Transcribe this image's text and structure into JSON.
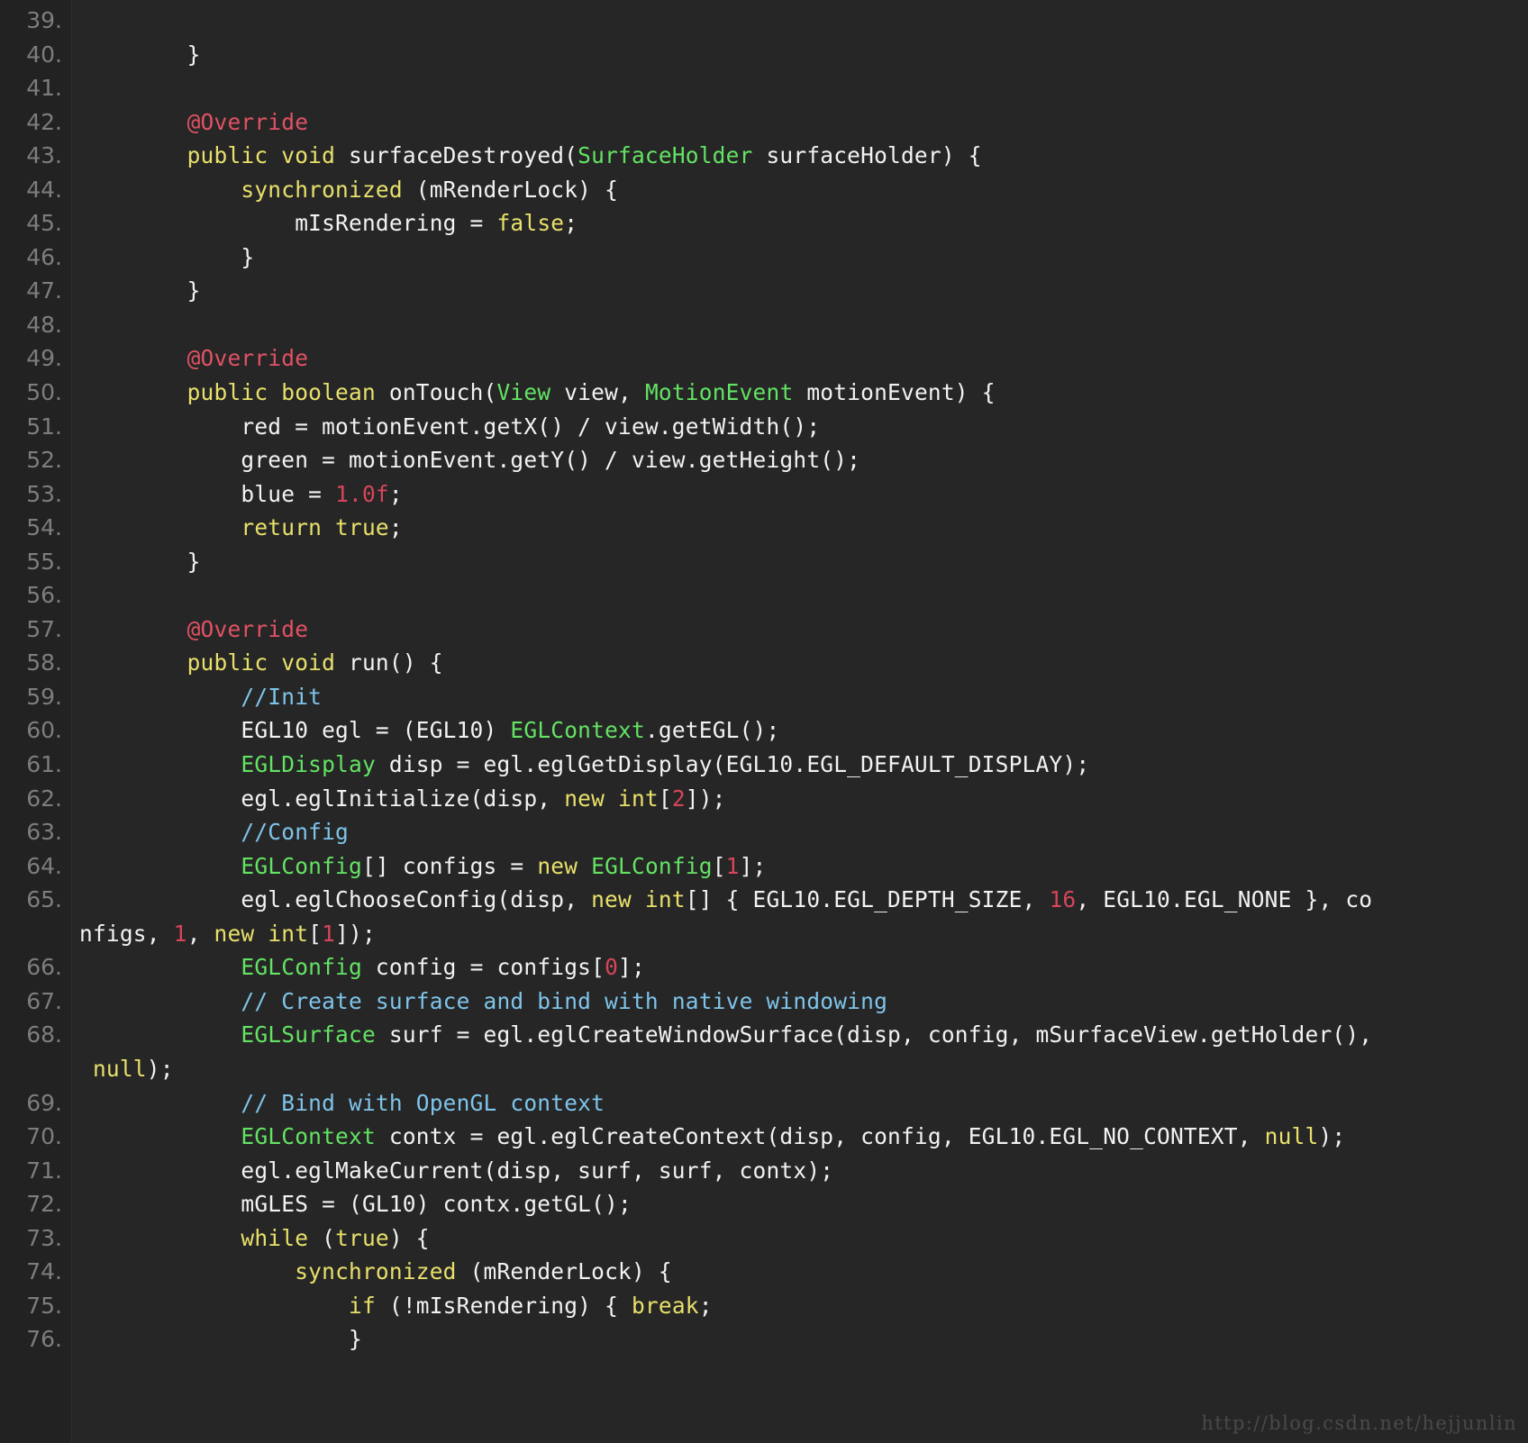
{
  "editor": {
    "background_color": "#262626",
    "gutter_color": "#222222",
    "line_number_color": "#7d7d7d",
    "language": "Java"
  },
  "colors": {
    "keyword": "#e8e06a",
    "type": "#63e363",
    "comment": "#7ec4ea",
    "annotation": "#e05264",
    "number": "#d6455a",
    "text": "#f2f2f2"
  },
  "watermark": {
    "text": "http://blog.csdn.net/hejjunlin"
  },
  "gutter": {
    "numbers": [
      "39.",
      "40.",
      "41.",
      "42.",
      "43.",
      "44.",
      "45.",
      "46.",
      "47.",
      "48.",
      "49.",
      "50.",
      "51.",
      "52.",
      "53.",
      "54.",
      "55.",
      "56.",
      "57.",
      "58.",
      "59.",
      "60.",
      "61.",
      "62.",
      "63.",
      "64.",
      "65.",
      "",
      "66.",
      "67.",
      "68.",
      "",
      "69.",
      "70.",
      "71.",
      "72.",
      "73.",
      "74.",
      "75.",
      "76."
    ]
  },
  "code": {
    "lines": [
      {
        "number": "39.",
        "tokens": []
      },
      {
        "number": "40.",
        "tokens": [
          {
            "t": "        }",
            "c": "txt"
          }
        ]
      },
      {
        "number": "41.",
        "tokens": []
      },
      {
        "number": "42.",
        "tokens": [
          {
            "t": "        ",
            "c": "txt"
          },
          {
            "t": "@Override",
            "c": "ann"
          }
        ]
      },
      {
        "number": "43.",
        "tokens": [
          {
            "t": "        ",
            "c": "txt"
          },
          {
            "t": "public void ",
            "c": "kw"
          },
          {
            "t": "surfaceDestroyed(",
            "c": "txt"
          },
          {
            "t": "SurfaceHolder",
            "c": "type"
          },
          {
            "t": " surfaceHolder) {",
            "c": "txt"
          }
        ]
      },
      {
        "number": "44.",
        "tokens": [
          {
            "t": "            ",
            "c": "txt"
          },
          {
            "t": "synchronized",
            "c": "kw"
          },
          {
            "t": " (mRenderLock) {",
            "c": "txt"
          }
        ]
      },
      {
        "number": "45.",
        "tokens": [
          {
            "t": "                mIsRendering = ",
            "c": "txt"
          },
          {
            "t": "false",
            "c": "kw"
          },
          {
            "t": ";",
            "c": "txt"
          }
        ]
      },
      {
        "number": "46.",
        "tokens": [
          {
            "t": "            }",
            "c": "txt"
          }
        ]
      },
      {
        "number": "47.",
        "tokens": [
          {
            "t": "        }",
            "c": "txt"
          }
        ]
      },
      {
        "number": "48.",
        "tokens": []
      },
      {
        "number": "49.",
        "tokens": [
          {
            "t": "        ",
            "c": "txt"
          },
          {
            "t": "@Override",
            "c": "ann"
          }
        ]
      },
      {
        "number": "50.",
        "tokens": [
          {
            "t": "        ",
            "c": "txt"
          },
          {
            "t": "public boolean ",
            "c": "kw"
          },
          {
            "t": "onTouch(",
            "c": "txt"
          },
          {
            "t": "View",
            "c": "type"
          },
          {
            "t": " view, ",
            "c": "txt"
          },
          {
            "t": "MotionEvent",
            "c": "type"
          },
          {
            "t": " motionEvent) {",
            "c": "txt"
          }
        ]
      },
      {
        "number": "51.",
        "tokens": [
          {
            "t": "            red = motionEvent.getX() / view.getWidth();",
            "c": "txt"
          }
        ]
      },
      {
        "number": "52.",
        "tokens": [
          {
            "t": "            green = motionEvent.getY() / view.getHeight();",
            "c": "txt"
          }
        ]
      },
      {
        "number": "53.",
        "tokens": [
          {
            "t": "            blue = ",
            "c": "txt"
          },
          {
            "t": "1.0f",
            "c": "num"
          },
          {
            "t": ";",
            "c": "txt"
          }
        ]
      },
      {
        "number": "54.",
        "tokens": [
          {
            "t": "            ",
            "c": "txt"
          },
          {
            "t": "return true",
            "c": "kw"
          },
          {
            "t": ";",
            "c": "txt"
          }
        ]
      },
      {
        "number": "55.",
        "tokens": [
          {
            "t": "        }",
            "c": "txt"
          }
        ]
      },
      {
        "number": "56.",
        "tokens": []
      },
      {
        "number": "57.",
        "tokens": [
          {
            "t": "        ",
            "c": "txt"
          },
          {
            "t": "@Override",
            "c": "ann"
          }
        ]
      },
      {
        "number": "58.",
        "tokens": [
          {
            "t": "        ",
            "c": "txt"
          },
          {
            "t": "public void ",
            "c": "kw"
          },
          {
            "t": "run() {",
            "c": "txt"
          }
        ]
      },
      {
        "number": "59.",
        "tokens": [
          {
            "t": "            ",
            "c": "txt"
          },
          {
            "t": "//Init",
            "c": "cmt"
          }
        ]
      },
      {
        "number": "60.",
        "tokens": [
          {
            "t": "            EGL10 egl = (EGL10) ",
            "c": "txt"
          },
          {
            "t": "EGLContext",
            "c": "type"
          },
          {
            "t": ".getEGL();",
            "c": "txt"
          }
        ]
      },
      {
        "number": "61.",
        "tokens": [
          {
            "t": "            ",
            "c": "txt"
          },
          {
            "t": "EGLDisplay",
            "c": "type"
          },
          {
            "t": " disp = egl.eglGetDisplay(EGL10.EGL_DEFAULT_DISPLAY);",
            "c": "txt"
          }
        ]
      },
      {
        "number": "62.",
        "tokens": [
          {
            "t": "            egl.eglInitialize(disp, ",
            "c": "txt"
          },
          {
            "t": "new int",
            "c": "kw"
          },
          {
            "t": "[",
            "c": "txt"
          },
          {
            "t": "2",
            "c": "num"
          },
          {
            "t": "]);",
            "c": "txt"
          }
        ]
      },
      {
        "number": "63.",
        "tokens": [
          {
            "t": "            ",
            "c": "txt"
          },
          {
            "t": "//Config",
            "c": "cmt"
          }
        ]
      },
      {
        "number": "64.",
        "tokens": [
          {
            "t": "            ",
            "c": "txt"
          },
          {
            "t": "EGLConfig",
            "c": "type"
          },
          {
            "t": "[] configs = ",
            "c": "txt"
          },
          {
            "t": "new ",
            "c": "kw"
          },
          {
            "t": "EGLConfig",
            "c": "type"
          },
          {
            "t": "[",
            "c": "txt"
          },
          {
            "t": "1",
            "c": "num"
          },
          {
            "t": "];",
            "c": "txt"
          }
        ]
      },
      {
        "number": "65.",
        "tokens": [
          {
            "t": "            egl.eglChooseConfig(disp, ",
            "c": "txt"
          },
          {
            "t": "new int",
            "c": "kw"
          },
          {
            "t": "[] { EGL10.EGL_DEPTH_SIZE, ",
            "c": "txt"
          },
          {
            "t": "16",
            "c": "num"
          },
          {
            "t": ", EGL10.EGL_NONE }, co",
            "c": "txt"
          }
        ]
      },
      {
        "number": "",
        "wrap": true,
        "tokens": [
          {
            "t": "nfigs, ",
            "c": "txt"
          },
          {
            "t": "1",
            "c": "num"
          },
          {
            "t": ", ",
            "c": "txt"
          },
          {
            "t": "new int",
            "c": "kw"
          },
          {
            "t": "[",
            "c": "txt"
          },
          {
            "t": "1",
            "c": "num"
          },
          {
            "t": "]);",
            "c": "txt"
          }
        ]
      },
      {
        "number": "66.",
        "tokens": [
          {
            "t": "            ",
            "c": "txt"
          },
          {
            "t": "EGLConfig",
            "c": "type"
          },
          {
            "t": " config = configs[",
            "c": "txt"
          },
          {
            "t": "0",
            "c": "num"
          },
          {
            "t": "];",
            "c": "txt"
          }
        ]
      },
      {
        "number": "67.",
        "tokens": [
          {
            "t": "            ",
            "c": "txt"
          },
          {
            "t": "// Create surface and bind with native windowing",
            "c": "cmt"
          }
        ]
      },
      {
        "number": "68.",
        "tokens": [
          {
            "t": "            ",
            "c": "txt"
          },
          {
            "t": "EGLSurface",
            "c": "type"
          },
          {
            "t": " surf = egl.eglCreateWindowSurface(disp, config, mSurfaceView.getHolder(),",
            "c": "txt"
          }
        ]
      },
      {
        "number": "",
        "wrap": true,
        "tokens": [
          {
            "t": " ",
            "c": "txt"
          },
          {
            "t": "null",
            "c": "kw"
          },
          {
            "t": ");",
            "c": "txt"
          }
        ]
      },
      {
        "number": "69.",
        "tokens": [
          {
            "t": "            ",
            "c": "txt"
          },
          {
            "t": "// Bind with OpenGL context",
            "c": "cmt"
          }
        ]
      },
      {
        "number": "70.",
        "tokens": [
          {
            "t": "            ",
            "c": "txt"
          },
          {
            "t": "EGLContext",
            "c": "type"
          },
          {
            "t": " contx = egl.eglCreateContext(disp, config, EGL10.EGL_NO_CONTEXT, ",
            "c": "txt"
          },
          {
            "t": "null",
            "c": "kw"
          },
          {
            "t": ");",
            "c": "txt"
          }
        ]
      },
      {
        "number": "71.",
        "tokens": [
          {
            "t": "            egl.eglMakeCurrent(disp, surf, surf, contx);",
            "c": "txt"
          }
        ]
      },
      {
        "number": "72.",
        "tokens": [
          {
            "t": "            mGLES = (GL10) contx.getGL();",
            "c": "txt"
          }
        ]
      },
      {
        "number": "73.",
        "tokens": [
          {
            "t": "            ",
            "c": "txt"
          },
          {
            "t": "while ",
            "c": "kw"
          },
          {
            "t": "(",
            "c": "txt"
          },
          {
            "t": "true",
            "c": "kw"
          },
          {
            "t": ") {",
            "c": "txt"
          }
        ]
      },
      {
        "number": "74.",
        "tokens": [
          {
            "t": "                ",
            "c": "txt"
          },
          {
            "t": "synchronized",
            "c": "kw"
          },
          {
            "t": " (mRenderLock) {",
            "c": "txt"
          }
        ]
      },
      {
        "number": "75.",
        "tokens": [
          {
            "t": "                    ",
            "c": "txt"
          },
          {
            "t": "if ",
            "c": "kw"
          },
          {
            "t": "(!mIsRendering) { ",
            "c": "txt"
          },
          {
            "t": "break",
            "c": "kw"
          },
          {
            "t": ";",
            "c": "txt"
          }
        ]
      },
      {
        "number": "76.",
        "tokens": [
          {
            "t": "                    }",
            "c": "txt"
          }
        ]
      }
    ]
  }
}
